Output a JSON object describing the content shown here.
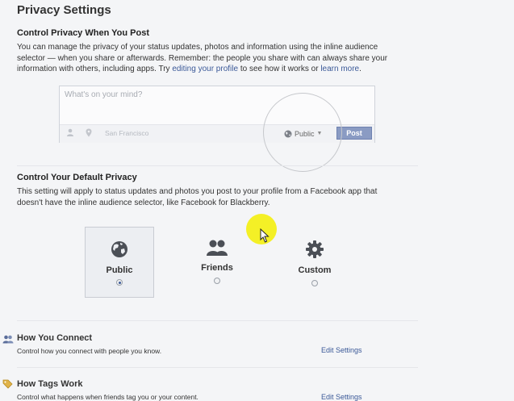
{
  "page": {
    "title": "Privacy Settings"
  },
  "control_post": {
    "title": "Control Privacy When You Post",
    "desc_line1": "You can manage the privacy of your status updates, photos and information using the inline audience",
    "desc_line2": "selector — when you share or afterwards. Remember: the people you share with can always share your",
    "desc_line3_pre": "information with others, including apps. Try ",
    "link_edit_profile": "editing your profile",
    "desc_line3_mid": " to see how it works or ",
    "link_learn_more": "learn more",
    "desc_line3_end": "."
  },
  "composer": {
    "placeholder": "What's on your mind?",
    "location": "San Francisco",
    "audience": "Public",
    "post_label": "Post"
  },
  "default_privacy": {
    "title": "Control Your Default Privacy",
    "desc_line1": "This setting will apply to status updates and photos you post to your profile from a Facebook app that",
    "desc_line2": "doesn't have the inline audience selector, like Facebook for Blackberry.",
    "options": [
      {
        "label": "Public",
        "selected": true,
        "icon": "globe-icon"
      },
      {
        "label": "Friends",
        "selected": false,
        "icon": "friends-icon"
      },
      {
        "label": "Custom",
        "selected": false,
        "icon": "gear-icon"
      }
    ]
  },
  "sections": [
    {
      "title": "How You Connect",
      "desc": "Control how you connect with people you know.",
      "edit_label": "Edit Settings",
      "icon": "people-icon"
    },
    {
      "title": "How Tags Work",
      "desc": "Control what happens when friends tag you or your content.",
      "edit_label": "Edit Settings",
      "icon": "tag-icon"
    }
  ],
  "colors": {
    "link": "#3b5998",
    "post_button": "#8a9bc3",
    "highlight": "#f3ef14"
  }
}
